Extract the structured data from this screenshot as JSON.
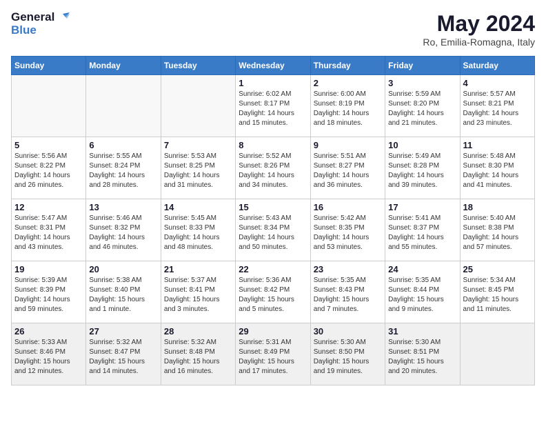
{
  "logo": {
    "text_general": "General",
    "text_blue": "Blue"
  },
  "title": "May 2024",
  "subtitle": "Ro, Emilia-Romagna, Italy",
  "days_of_week": [
    "Sunday",
    "Monday",
    "Tuesday",
    "Wednesday",
    "Thursday",
    "Friday",
    "Saturday"
  ],
  "weeks": [
    [
      {
        "day": "",
        "info": ""
      },
      {
        "day": "",
        "info": ""
      },
      {
        "day": "",
        "info": ""
      },
      {
        "day": "1",
        "info": "Sunrise: 6:02 AM\nSunset: 8:17 PM\nDaylight: 14 hours\nand 15 minutes."
      },
      {
        "day": "2",
        "info": "Sunrise: 6:00 AM\nSunset: 8:19 PM\nDaylight: 14 hours\nand 18 minutes."
      },
      {
        "day": "3",
        "info": "Sunrise: 5:59 AM\nSunset: 8:20 PM\nDaylight: 14 hours\nand 21 minutes."
      },
      {
        "day": "4",
        "info": "Sunrise: 5:57 AM\nSunset: 8:21 PM\nDaylight: 14 hours\nand 23 minutes."
      }
    ],
    [
      {
        "day": "5",
        "info": "Sunrise: 5:56 AM\nSunset: 8:22 PM\nDaylight: 14 hours\nand 26 minutes."
      },
      {
        "day": "6",
        "info": "Sunrise: 5:55 AM\nSunset: 8:24 PM\nDaylight: 14 hours\nand 28 minutes."
      },
      {
        "day": "7",
        "info": "Sunrise: 5:53 AM\nSunset: 8:25 PM\nDaylight: 14 hours\nand 31 minutes."
      },
      {
        "day": "8",
        "info": "Sunrise: 5:52 AM\nSunset: 8:26 PM\nDaylight: 14 hours\nand 34 minutes."
      },
      {
        "day": "9",
        "info": "Sunrise: 5:51 AM\nSunset: 8:27 PM\nDaylight: 14 hours\nand 36 minutes."
      },
      {
        "day": "10",
        "info": "Sunrise: 5:49 AM\nSunset: 8:28 PM\nDaylight: 14 hours\nand 39 minutes."
      },
      {
        "day": "11",
        "info": "Sunrise: 5:48 AM\nSunset: 8:30 PM\nDaylight: 14 hours\nand 41 minutes."
      }
    ],
    [
      {
        "day": "12",
        "info": "Sunrise: 5:47 AM\nSunset: 8:31 PM\nDaylight: 14 hours\nand 43 minutes."
      },
      {
        "day": "13",
        "info": "Sunrise: 5:46 AM\nSunset: 8:32 PM\nDaylight: 14 hours\nand 46 minutes."
      },
      {
        "day": "14",
        "info": "Sunrise: 5:45 AM\nSunset: 8:33 PM\nDaylight: 14 hours\nand 48 minutes."
      },
      {
        "day": "15",
        "info": "Sunrise: 5:43 AM\nSunset: 8:34 PM\nDaylight: 14 hours\nand 50 minutes."
      },
      {
        "day": "16",
        "info": "Sunrise: 5:42 AM\nSunset: 8:35 PM\nDaylight: 14 hours\nand 53 minutes."
      },
      {
        "day": "17",
        "info": "Sunrise: 5:41 AM\nSunset: 8:37 PM\nDaylight: 14 hours\nand 55 minutes."
      },
      {
        "day": "18",
        "info": "Sunrise: 5:40 AM\nSunset: 8:38 PM\nDaylight: 14 hours\nand 57 minutes."
      }
    ],
    [
      {
        "day": "19",
        "info": "Sunrise: 5:39 AM\nSunset: 8:39 PM\nDaylight: 14 hours\nand 59 minutes."
      },
      {
        "day": "20",
        "info": "Sunrise: 5:38 AM\nSunset: 8:40 PM\nDaylight: 15 hours\nand 1 minute."
      },
      {
        "day": "21",
        "info": "Sunrise: 5:37 AM\nSunset: 8:41 PM\nDaylight: 15 hours\nand 3 minutes."
      },
      {
        "day": "22",
        "info": "Sunrise: 5:36 AM\nSunset: 8:42 PM\nDaylight: 15 hours\nand 5 minutes."
      },
      {
        "day": "23",
        "info": "Sunrise: 5:35 AM\nSunset: 8:43 PM\nDaylight: 15 hours\nand 7 minutes."
      },
      {
        "day": "24",
        "info": "Sunrise: 5:35 AM\nSunset: 8:44 PM\nDaylight: 15 hours\nand 9 minutes."
      },
      {
        "day": "25",
        "info": "Sunrise: 5:34 AM\nSunset: 8:45 PM\nDaylight: 15 hours\nand 11 minutes."
      }
    ],
    [
      {
        "day": "26",
        "info": "Sunrise: 5:33 AM\nSunset: 8:46 PM\nDaylight: 15 hours\nand 12 minutes."
      },
      {
        "day": "27",
        "info": "Sunrise: 5:32 AM\nSunset: 8:47 PM\nDaylight: 15 hours\nand 14 minutes."
      },
      {
        "day": "28",
        "info": "Sunrise: 5:32 AM\nSunset: 8:48 PM\nDaylight: 15 hours\nand 16 minutes."
      },
      {
        "day": "29",
        "info": "Sunrise: 5:31 AM\nSunset: 8:49 PM\nDaylight: 15 hours\nand 17 minutes."
      },
      {
        "day": "30",
        "info": "Sunrise: 5:30 AM\nSunset: 8:50 PM\nDaylight: 15 hours\nand 19 minutes."
      },
      {
        "day": "31",
        "info": "Sunrise: 5:30 AM\nSunset: 8:51 PM\nDaylight: 15 hours\nand 20 minutes."
      },
      {
        "day": "",
        "info": ""
      }
    ]
  ]
}
